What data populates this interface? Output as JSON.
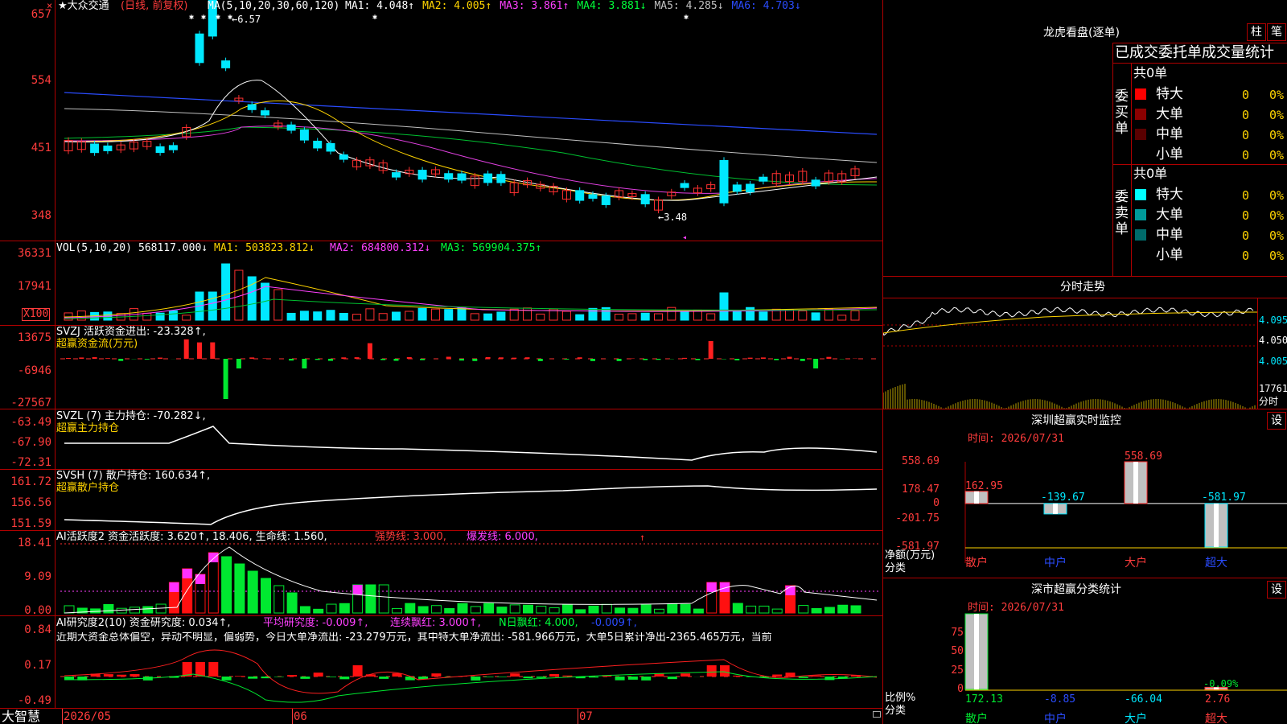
{
  "main": {
    "stock_title": "★大众交通",
    "period_label": "(日线, 前复权)",
    "ma_header": "MA(5,10,20,30,60,120)",
    "ma_values": [
      {
        "label": "MA1:",
        "value": "4.048↑",
        "color": "#ffffff"
      },
      {
        "label": "MA2:",
        "value": "4.005↑",
        "color": "#ffd400"
      },
      {
        "label": "MA3:",
        "value": "3.861↑",
        "color": "#ff40ff"
      },
      {
        "label": "MA4:",
        "value": "3.881↓",
        "color": "#00ff3a"
      },
      {
        "label": "MA5:",
        "value": "4.285↓",
        "color": "#c0c0c0"
      },
      {
        "label": "MA6:",
        "value": "4.703↓",
        "color": "#2a4cff"
      }
    ],
    "price_axis": [
      "657",
      "554",
      "451",
      "348"
    ],
    "high_marker": "←6.57",
    "low_marker": "←3.48"
  },
  "volume": {
    "header": "VOL(5,10,20)",
    "value": "568117.000↓",
    "ma1": "MA1: 503823.812↓",
    "ma2": "MA2: 684800.312↓",
    "ma3": "MA3: 569904.375↑",
    "axis": [
      "36331",
      "17941"
    ],
    "unit": "X100"
  },
  "svzj": {
    "header": "SVZJ  活跃资金进出: -23.328↑,",
    "subtitle": "超赢资金流(万元)",
    "axis": [
      "13675",
      "-6946",
      "-27567"
    ]
  },
  "svzl": {
    "header": "SVZL (7) 主力持仓: -70.282↓,",
    "subtitle": "超赢主力持仓",
    "axis": [
      "-63.49",
      "-67.90",
      "-72.31"
    ]
  },
  "svsh": {
    "header": "SVSH (7) 散户持仓: 160.634↑,",
    "subtitle": "超赢散户持仓",
    "axis": [
      "161.72",
      "156.56",
      "151.59"
    ]
  },
  "ai_active": {
    "header": "AI活跃度2 资金活跃度: 3.620↑, 18.406, 生命线: 1.560,",
    "strong": "强势线: 3.000,",
    "burst": "爆发线: 6.000,",
    "axis": [
      "18.41",
      "9.09",
      "0.00"
    ]
  },
  "ai_research": {
    "header": "AI研究度2(10) 资金研究度: 0.034↑,",
    "avg": "平均研究度: -0.009↑,",
    "streak": "连续飘红: 3.000↑,",
    "nday": "N日飘红: 4.000,",
    "extra": "-0.009↑,",
    "commentary": "近期大资金总体偏空，异动不明显，偏弱势，今日大单净流出: -23.279万元，其中特大单净流出: -581.966万元，大单5日累计净出-2365.465万元，当前",
    "axis": [
      "0.84",
      "0.17",
      "-0.49"
    ]
  },
  "bottom_bar": {
    "brand": "大智慧",
    "dates": [
      "2026/05",
      "06",
      "07"
    ]
  },
  "right": {
    "panel_title": "龙虎看盘(逐单)",
    "tab_pillar": "柱",
    "tab_stroke": "笔",
    "stats_header": "已成交委托单成交量统计",
    "buy_group": {
      "label": "委买单",
      "total": "共0单",
      "rows": [
        {
          "label": "特大",
          "count": "0",
          "pct": "0%",
          "color": "#ff0000"
        },
        {
          "label": "大单",
          "count": "0",
          "pct": "0%",
          "color": "#8b0000"
        },
        {
          "label": "中单",
          "count": "0",
          "pct": "0%",
          "color": "#5a0000"
        },
        {
          "label": "小单",
          "count": "0",
          "pct": "0%",
          "color": ""
        }
      ]
    },
    "sell_group": {
      "label": "委卖单",
      "total": "共0单",
      "rows": [
        {
          "label": "特大",
          "count": "0",
          "pct": "0%",
          "color": "#00ffff"
        },
        {
          "label": "大单",
          "count": "0",
          "pct": "0%",
          "color": "#009a9a"
        },
        {
          "label": "中单",
          "count": "0",
          "pct": "0%",
          "color": "#006a6a"
        },
        {
          "label": "小单",
          "count": "0",
          "pct": "0%",
          "color": ""
        }
      ]
    },
    "intraday": {
      "title": "分时走势",
      "price_axis": [
        "4.095",
        "4.050",
        "4.005"
      ],
      "vol_axis": "17761",
      "vol_label": "分时"
    },
    "sz_monitor": {
      "title": "深圳超赢实时监控",
      "btn": "设",
      "time": "时间: 2026/07/31",
      "axis": [
        "558.69",
        "178.47",
        "0",
        "-201.75",
        "-581.97"
      ],
      "ylabel": "净额(万元)",
      "xlabel": "分类",
      "chart_data": {
        "type": "bar",
        "categories": [
          "散户",
          "中户",
          "大户",
          "超大"
        ],
        "values": [
          162.95,
          -139.67,
          558.69,
          -581.97
        ],
        "value_labels": [
          "162.95",
          "-139.67",
          "558.69",
          "-581.97"
        ],
        "ylim": [
          -581.97,
          558.69
        ],
        "ylabel": "净额(万元)",
        "xlabel": "分类"
      }
    },
    "sz_classify": {
      "title": "深市超赢分类统计",
      "btn": "设",
      "time": "时间: 2026/07/31",
      "axis": [
        "75",
        "50",
        "25",
        "0"
      ],
      "ylabel": "比例%",
      "xlabel": "分类",
      "chart_data": {
        "type": "bar",
        "categories": [
          "散户",
          "中户",
          "大户",
          "超大"
        ],
        "values": [
          172.13,
          -8.85,
          -66.04,
          2.76
        ],
        "value_labels": [
          "172.13",
          "-8.85",
          "-66.04",
          "2.76"
        ],
        "extra_label": "-0.09%",
        "ylim": [
          0,
          100
        ]
      }
    }
  }
}
